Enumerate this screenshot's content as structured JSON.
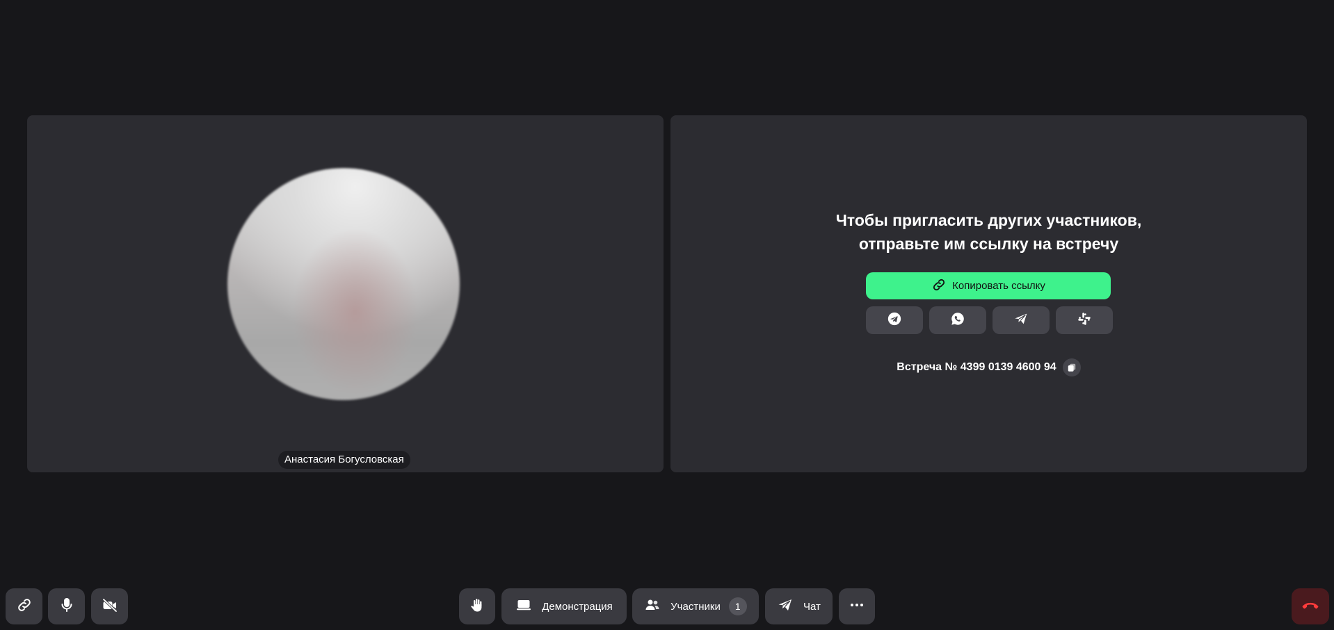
{
  "participant": {
    "name": "Анастасия Богусловская"
  },
  "invite": {
    "line1": "Чтобы пригласить других участников,",
    "line2": "отправьте им ссылку на встречу",
    "copy_link_label": "Копировать ссылку",
    "share_targets": [
      "telegram-icon",
      "whatsapp-icon",
      "send-icon",
      "slack-icon"
    ],
    "meeting_label": "Встреча № 4399 0139 4600 94"
  },
  "toolbar": {
    "demo_label": "Демонстрация",
    "participants_label": "Участники",
    "participants_count": "1",
    "chat_label": "Чат"
  },
  "colors": {
    "background": "#17171a",
    "tile": "#2c2c31",
    "accent_green": "#3ef28c",
    "button": "#3a3a40",
    "end_call": "#4a1a1e",
    "end_call_icon": "#ff3b3b"
  }
}
